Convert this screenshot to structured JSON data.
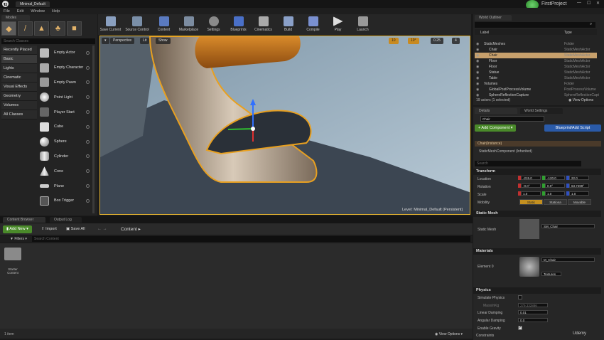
{
  "window": {
    "title": "Minimal_Default",
    "project": "FirstProject"
  },
  "menu": [
    "File",
    "Edit",
    "Window",
    "Help"
  ],
  "modes": {
    "tab": "Modes",
    "search_placeholder": "Search Classes",
    "categories": [
      "Recently Placed",
      "Basic",
      "Lights",
      "Cinematic",
      "Visual Effects",
      "Geometry",
      "Volumes",
      "All Classes"
    ],
    "actors": [
      "Empty Actor",
      "Empty Character",
      "Empty Pawn",
      "Point Light",
      "Player Start",
      "Cube",
      "Sphere",
      "Cylinder",
      "Cone",
      "Plane",
      "Box Trigger"
    ]
  },
  "toolbar": [
    "Save Current",
    "Source Control",
    "Content",
    "Marketplace",
    "Settings",
    "Blueprints",
    "Cinematics",
    "Build",
    "Compile",
    "Play",
    "Launch"
  ],
  "viewport": {
    "perspective": "Perspective",
    "lit": "Lit",
    "show": "Show",
    "grid_snap": "10",
    "rot_snap": "10°",
    "scale_snap": "0.25",
    "cam_speed": "4",
    "level_label": "Level:",
    "level_name": "Minimal_Default (Persistent)"
  },
  "content_browser": {
    "tab1": "Content Browser",
    "tab2": "Output Log",
    "add_new": "Add New",
    "import": "Import",
    "save_all": "Save All",
    "path": "Content",
    "filters": "Filters",
    "search_placeholder": "Search Content",
    "folder": "Starter Content",
    "item_count": "1 item",
    "view_options": "View Options"
  },
  "outliner": {
    "tab": "World Outliner",
    "col_label": "Label",
    "col_type": "Type",
    "rows": [
      {
        "label": "StaticMeshes",
        "type": "Folder",
        "indent": 1
      },
      {
        "label": "Chair",
        "type": "StaticMeshActor",
        "indent": 2
      },
      {
        "label": "Chair",
        "type": "StaticMeshActor",
        "indent": 2,
        "selected": true
      },
      {
        "label": "Floor",
        "type": "StaticMeshActor",
        "indent": 2
      },
      {
        "label": "Floor",
        "type": "StaticMeshActor",
        "indent": 2
      },
      {
        "label": "Statue",
        "type": "StaticMeshActor",
        "indent": 2
      },
      {
        "label": "Table",
        "type": "StaticMeshActor",
        "indent": 2
      },
      {
        "label": "Volumes",
        "type": "Folder",
        "indent": 1
      },
      {
        "label": "GlobalPostProcessVolume",
        "type": "PostProcessVolume",
        "indent": 2
      },
      {
        "label": "SphereReflectionCapture",
        "type": "SphereReflectionCapt",
        "indent": 2
      }
    ],
    "status": "19 actors (1 selected)",
    "view_options": "View Options"
  },
  "details": {
    "tab1": "Details",
    "tab2": "World Settings",
    "name": "Chair",
    "add_component": "+ Add Component",
    "blueprint": "Blueprint/Add Script",
    "instance": "Chair(Instance)",
    "component": "StaticMeshComponent (Inherited)",
    "search_placeholder": "Search",
    "transform": "Transform",
    "location_label": "Location",
    "location": [
      "-215.0",
      "-120.0",
      "22.0"
    ],
    "rotation_label": "Rotation",
    "rotation": [
      "-0.0°",
      "0.0°",
      "63.7499°"
    ],
    "scale_label": "Scale",
    "scale": [
      "1.0",
      "1.0",
      "1.0"
    ],
    "mobility_label": "Mobility",
    "mobility": [
      "Static",
      "Stationa",
      "Movable"
    ],
    "static_mesh_section": "Static Mesh",
    "static_mesh_label": "Static Mesh",
    "static_mesh_value": "SM_Chair",
    "materials_section": "Materials",
    "element_label": "Element 0",
    "material_value": "M_Chair",
    "textures": "Textures",
    "physics_section": "Physics",
    "simulate_physics": "Simulate Physics",
    "mass_label": "MassInKg",
    "mass_value": "279.332886",
    "linear_damping_label": "Linear Damping",
    "linear_damping": "0.01",
    "angular_damping_label": "Angular Damping",
    "angular_damping": "0.0",
    "enable_gravity": "Enable Gravity",
    "constraints": "Constraints"
  },
  "watermark": "Udemy"
}
